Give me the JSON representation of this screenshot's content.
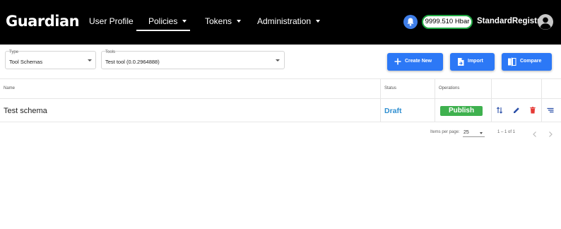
{
  "app": {
    "logo": "Guardian"
  },
  "nav": {
    "items": [
      {
        "label": "User Profile",
        "has_menu": false
      },
      {
        "label": "Policies",
        "has_menu": true,
        "active": true
      },
      {
        "label": "Tokens",
        "has_menu": true
      },
      {
        "label": "Administration",
        "has_menu": true
      }
    ]
  },
  "header": {
    "balance": "9999.510 Hbar",
    "username": "StandardRegistry",
    "bell_icon": "bell-icon",
    "avatar_icon": "account-circle-icon"
  },
  "filters": {
    "type": {
      "label": "Type",
      "value": "Tool Schemas"
    },
    "tools": {
      "label": "Tools",
      "value": "Test tool (0.0.2964888)"
    }
  },
  "actions": {
    "create_label": "Create New",
    "import_label": "Import",
    "compare_label": "Compare"
  },
  "table": {
    "columns": [
      "Name",
      "Status",
      "Operations"
    ],
    "rows": [
      {
        "name": "Test schema",
        "status": "Draft",
        "operation": "Publish"
      }
    ]
  },
  "paginator": {
    "items_per_page_label": "Items per page:",
    "page_size": "25",
    "range": "1 – 1 of 1"
  },
  "colors": {
    "topbar": "#000000",
    "primary_button": "#2c78f6",
    "publish": "#3fb14f",
    "draft": "#2f8fd1",
    "balance_border": "#21a843",
    "delete": "#e53935",
    "edit": "#2a4fa8"
  }
}
